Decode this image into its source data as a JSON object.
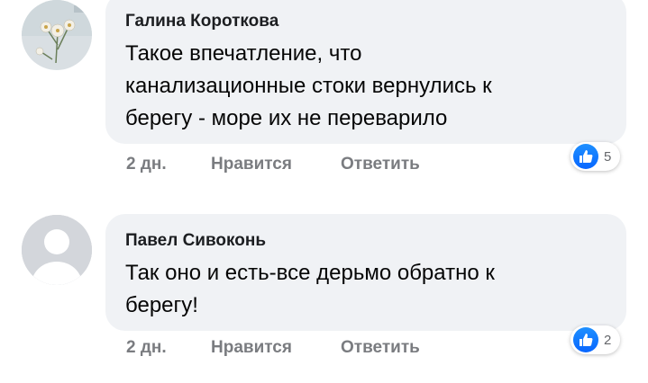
{
  "comments": [
    {
      "author": "Галина Короткова",
      "text_lines": [
        "Такое впечатление, что",
        "канализационные стоки вернулись к",
        "берегу - море их не переварило"
      ],
      "time": "2 дн.",
      "like_label": "Нравится",
      "reply_label": "Ответить",
      "reaction_count": "5",
      "reaction_icon": "like-icon",
      "avatar_icon": "flower-avatar"
    },
    {
      "author": "Павел Сивоконь",
      "text_lines": [
        "Так оно и есть-все дерьмо обратно к",
        "берегу!"
      ],
      "time": "2 дн.",
      "like_label": "Нравится",
      "reply_label": "Ответить",
      "reaction_count": "2",
      "reaction_icon": "like-icon",
      "avatar_icon": "default-user-avatar"
    }
  ],
  "colors": {
    "bubble": "#f0f2f5",
    "like_blue": "#0866ff",
    "meta_gray": "#7a7c80"
  }
}
